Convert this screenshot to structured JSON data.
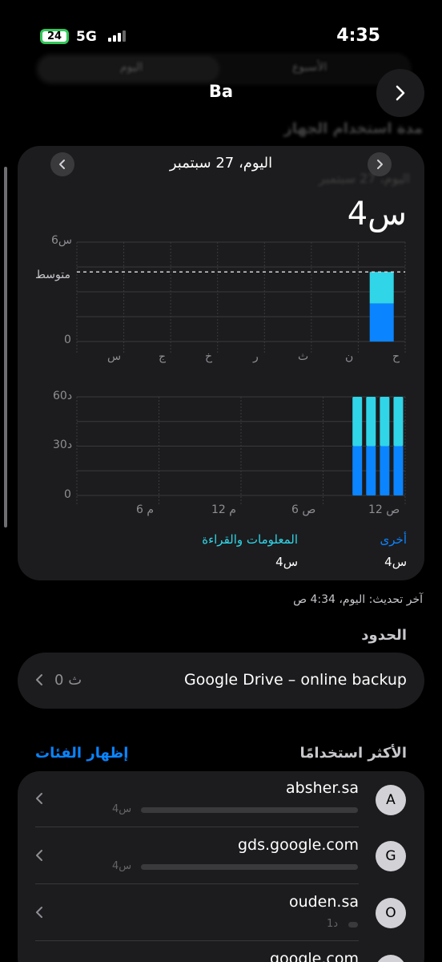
{
  "status_bar": {
    "battery": "24",
    "network": "5G",
    "time": "4:35"
  },
  "nav": {
    "title": "Ba"
  },
  "ghost": {
    "segment_left": "الأسبوع",
    "segment_right": "اليوم",
    "header": "مدة استخدام الجهاز",
    "date": "اليوم، 27 سبتمبر"
  },
  "chart_card": {
    "date_label": "اليوم، 27 سبتمبر",
    "total": "4س",
    "weekly_y_labels": {
      "top": "6س",
      "avg": "متوسط",
      "zero": "0"
    },
    "days": [
      "ح",
      "ن",
      "ث",
      "ر",
      "خ",
      "ج",
      "س"
    ],
    "hourly_y_labels": {
      "top": "60د",
      "mid": "30د",
      "zero": "0"
    },
    "hourly_x_labels": [
      "12 ص",
      "6 ص",
      "12 م",
      "6 م"
    ],
    "legend": [
      {
        "category": "أخرى",
        "value": "4س",
        "color": "#0a84ff"
      },
      {
        "category": "المعلومات والقراءة",
        "value": "4س",
        "color": "#30d5e8"
      }
    ]
  },
  "chart_data": [
    {
      "type": "bar",
      "categories": [
        "ح",
        "ن",
        "ث",
        "ر",
        "خ",
        "ج",
        "س"
      ],
      "series": [
        {
          "name": "أخرى",
          "values": [
            2.3,
            0,
            0,
            0,
            0,
            0,
            0
          ]
        },
        {
          "name": "المعلومات والقراءة",
          "values": [
            1.9,
            0,
            0,
            0,
            0,
            0,
            0
          ]
        }
      ],
      "ylim": [
        0,
        6
      ],
      "average": 4.2,
      "stacked": true
    },
    {
      "type": "bar",
      "categories": [
        "12 ص",
        "",
        "",
        "",
        "",
        "",
        "6 ص",
        "",
        "",
        "",
        "",
        "",
        "12 م",
        "",
        "",
        "",
        "",
        "",
        "6 م",
        "",
        "",
        "",
        "",
        ""
      ],
      "series": [
        {
          "name": "أخرى",
          "values": [
            30,
            30,
            30,
            30,
            0,
            0,
            0,
            0,
            0,
            0,
            0,
            0,
            0,
            0,
            0,
            0,
            0,
            0,
            0,
            0,
            0,
            0,
            0,
            0
          ]
        },
        {
          "name": "المعلومات والقراءة",
          "values": [
            30,
            30,
            30,
            30,
            0,
            0,
            0,
            0,
            0,
            0,
            0,
            0,
            0,
            0,
            0,
            0,
            0,
            0,
            0,
            0,
            0,
            0,
            0,
            0
          ]
        }
      ],
      "ylim": [
        0,
        60
      ],
      "stacked": true
    }
  ],
  "updated": "آخر تحديث: اليوم، 4:34 ص",
  "limits": {
    "heading": "الحدود",
    "app": "Google Drive – online backup",
    "value": "0 ث"
  },
  "most_used": {
    "heading": "الأكثر استخدامًا",
    "show_categories": "إظهار الفئات",
    "items": [
      {
        "initial": "A",
        "name": "absher.sa",
        "duration": "4س",
        "fraction": 1.0
      },
      {
        "initial": "G",
        "name": "gds.google.com",
        "duration": "4س",
        "fraction": 1.0
      },
      {
        "initial": "O",
        "name": "ouden.sa",
        "duration": "1د",
        "fraction": 0.02
      },
      {
        "initial": "G",
        "name": "google.com",
        "duration": "",
        "fraction": 0.0
      }
    ]
  }
}
